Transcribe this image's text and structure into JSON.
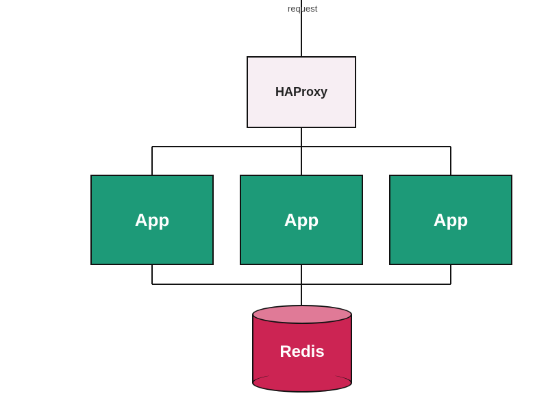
{
  "diagram": {
    "request_label": "request",
    "haproxy": {
      "label": "HAProxy"
    },
    "apps": [
      {
        "label": "App"
      },
      {
        "label": "App"
      },
      {
        "label": "App"
      }
    ],
    "redis": {
      "label": "Redis"
    },
    "colors": {
      "app_bg": "#1d9a78",
      "haproxy_bg": "#f7eef3",
      "redis_body": "#cc2453",
      "redis_top": "#e07a97",
      "border": "#111111"
    },
    "connections": [
      {
        "from": "request",
        "to": "haproxy"
      },
      {
        "from": "haproxy",
        "to": "app1"
      },
      {
        "from": "haproxy",
        "to": "app2"
      },
      {
        "from": "haproxy",
        "to": "app3"
      },
      {
        "from": "app1",
        "to": "redis"
      },
      {
        "from": "app2",
        "to": "redis"
      },
      {
        "from": "app3",
        "to": "redis"
      }
    ]
  }
}
